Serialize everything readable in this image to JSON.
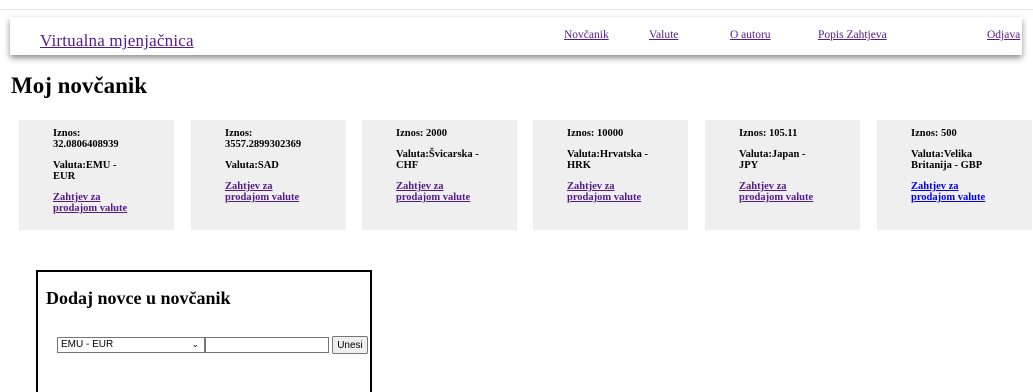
{
  "header": {
    "brand": "Virtualna mjenjačnica",
    "nav": [
      "Novčanik",
      "Valute",
      "O autoru",
      "Popis Zahtjeva",
      "Odjava"
    ]
  },
  "page": {
    "title": "Moj novčanik"
  },
  "wallet": {
    "cards": [
      {
        "amount": "Iznos:\n32.0806408939",
        "currency": "Valuta:EMU -\nEUR",
        "link": "Zahtjev za\nprodajom valute"
      },
      {
        "amount": "Iznos:\n3557.2899302369",
        "currency": "Valuta:SAD",
        "link": "Zahtjev za\nprodajom valute"
      },
      {
        "amount": "Iznos: 2000",
        "currency": "Valuta:Švicarska -\nCHF",
        "link": "Zahtjev za\nprodajom valute"
      },
      {
        "amount": "Iznos: 10000",
        "currency": "Valuta:Hrvatska -\nHRK",
        "link": "Zahtjev za\nprodajom valute"
      },
      {
        "amount": "Iznos: 105.11",
        "currency": "Valuta:Japan -\nJPY",
        "link": "Zahtjev za\nprodajom valute"
      },
      {
        "amount": "Iznos: 500",
        "currency": "Valuta:Velika\nBritanija - GBP",
        "link": "Zahtjev za\nprodajom valute"
      }
    ]
  },
  "add_money": {
    "title": "Dodaj novce u novčanik",
    "selected_currency": "EMU - EUR",
    "amount_value": "",
    "submit_label": "Unesi"
  },
  "icons": {
    "select_arrow": "chevron-down-icon"
  },
  "colors": {
    "visited_link": "#551a8b",
    "unvisited_link": "#0000ee",
    "card_bg": "#efefef"
  }
}
